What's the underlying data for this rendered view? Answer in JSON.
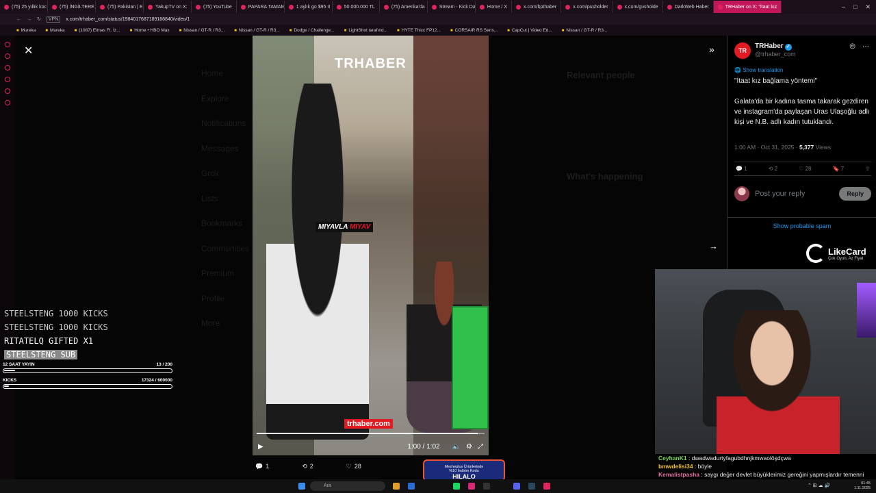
{
  "browser": {
    "tabs": [
      {
        "label": "(75) 25 yıllık koc"
      },
      {
        "label": "(75) İNGİLTERE"
      },
      {
        "label": "(75) Pakistan | E"
      },
      {
        "label": "YakupTV on X:"
      },
      {
        "label": "(75) YouTube"
      },
      {
        "label": "PAPARA TAMAM"
      },
      {
        "label": "1 aylık go $95 II"
      },
      {
        "label": "50.000.000 TL"
      },
      {
        "label": "(75) Amerika'da"
      },
      {
        "label": "Stream - Kick Da"
      },
      {
        "label": "Home / X"
      },
      {
        "label": "x.com/bpthaber"
      },
      {
        "label": "x.com/pusholder"
      },
      {
        "label": "x.com/gusholde"
      },
      {
        "label": "DarkWeb Haber"
      },
      {
        "label": "TRHaber on X: \"İtaat kız"
      }
    ],
    "url": "x.com/trhaber_com/status/1984017687189188840/video/1",
    "vpn_label": "VPN",
    "bookmarks": [
      "Mureka",
      "Mureka",
      "(1087) Elmas Ft. İz...",
      "Home • HBO Max",
      "Nissan / GT-R / R3...",
      "Nissan / GT-R / R3...",
      "Dodge / Challenge...",
      "LightShot tarafınd...",
      "HYTE Thicc FP12...",
      "CORSAIR RS Seris...",
      "CapCut | Video Ed...",
      "Nissan / GT-R / R3..."
    ]
  },
  "background_nav": [
    "Home",
    "Explore",
    "Notifications",
    "Messages",
    "Grok",
    "Lists",
    "Bookmarks",
    "Communities",
    "Premium",
    "Profile",
    "More"
  ],
  "background_right": {
    "relevant": "Relevant people",
    "happening": "What's happening"
  },
  "video": {
    "logo": "TRHABER",
    "caption_white": "MIYAVLA ",
    "caption_red": "MIYAV",
    "watermark": "trhaber.com",
    "time": "1:00 / 1:02",
    "progress": 0.97
  },
  "actions": {
    "replies": "1",
    "reposts": "2",
    "likes": "28"
  },
  "tweet": {
    "name": "TRHaber",
    "handle": "@trhaber_com",
    "show_translation": "Show translation",
    "text": "\"İtaat kız bağlama yöntemi\"\n\nGalata'da bir kadına tasma takarak gezdiren ve instagram'da paylaşan Uras Ulaşoğlu adlı kişi ve N.B. adlı kadın tutuklandı.",
    "time": "1:00 AM · Oct 31, 2025 · ",
    "views_count": "5,377",
    "views_label": " Views",
    "stats": {
      "replies": "1",
      "reposts": "2",
      "likes": "28",
      "bookmarks": "7"
    },
    "reply_placeholder": "Post your reply",
    "reply_button": "Reply",
    "probable_spam": "Show probable spam"
  },
  "likecard": {
    "name": "LikeCard",
    "tagline": "Çok Oyun, Az Fiyat"
  },
  "overlay": {
    "feed": [
      "STEELSTENG  1000 KICKS",
      "STEELSTENG  1000 KICKS",
      "RITATELQ  GIFTED X1",
      "STEELSTENG  SUB"
    ],
    "goal1": {
      "label": "12 SAAT YAYIN",
      "value": "13 / 200",
      "fraction": 0.065
    },
    "goal2": {
      "label": "KICKS",
      "value": "17324 / 600000",
      "fraction": 0.029
    }
  },
  "chat": [
    {
      "user": "CeyhanK1",
      "msg": " : dwadwadurtyfagubdhnjkmwaolöşdçwa"
    },
    {
      "user": "bmwdelisi34",
      "msg": " : böyle"
    },
    {
      "user": "Kemalistpasha",
      "msg": " : saygı değer devlet büyüklerimiz gereğini yapmışlardır temenni ediyoruz."
    }
  ],
  "promo": {
    "line1": "Mezheplus Ürünlerinde",
    "line2": "%10 İndirim Kodu",
    "code": "HILALO"
  },
  "taskbar": {
    "search": "Ara",
    "time": "01:45",
    "date": "1.11.2025"
  }
}
